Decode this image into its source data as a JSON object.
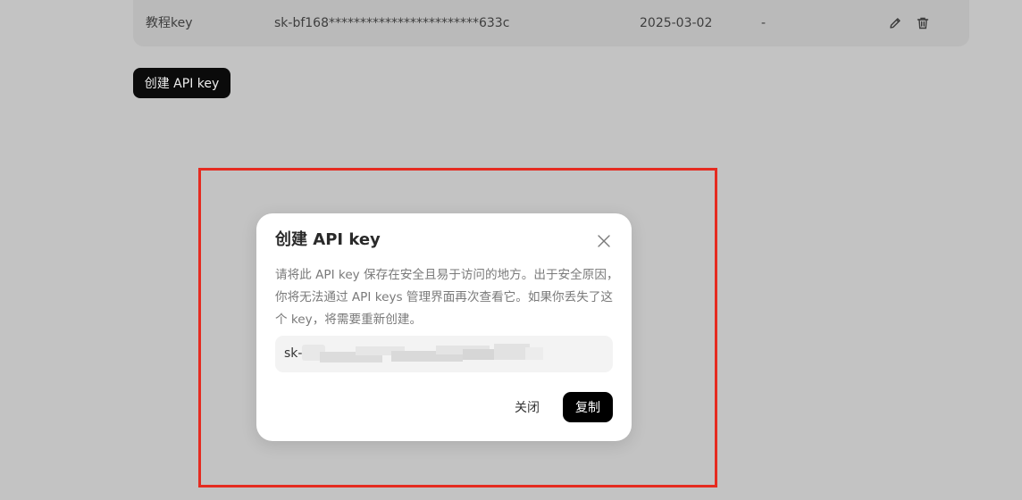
{
  "key_table": {
    "row": {
      "name": "教程key",
      "key": "sk-bf168************************633c",
      "created": "2025-03-02",
      "last_used": "-",
      "edit_icon": "pencil-icon",
      "delete_icon": "trash-icon"
    }
  },
  "create_button_label": "创建 API key",
  "modal": {
    "title": "创建 API key",
    "close_icon": "close-icon",
    "description": "请将此 API key 保存在安全且易于访问的地方。出于安全原因，你将无法通过 API keys 管理界面再次查看它。如果你丢失了这个 key，将需要重新创建。",
    "key_prefix": "sk-",
    "close_label": "关闭",
    "copy_label": "复制"
  },
  "colors": {
    "overlay": "#c3c3c3",
    "highlight": "#e52b20",
    "primary_button": "#000000"
  }
}
